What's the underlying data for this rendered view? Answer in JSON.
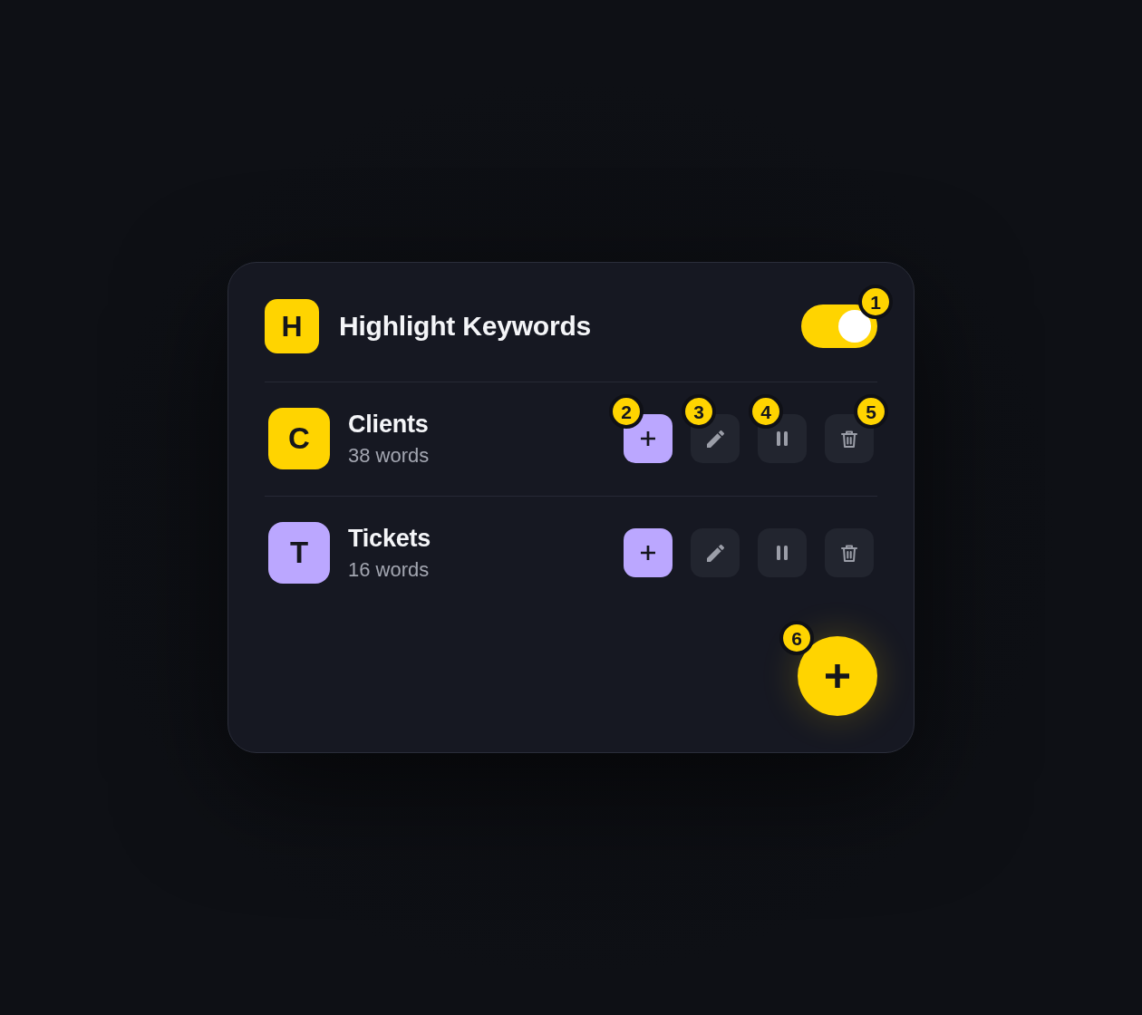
{
  "header": {
    "avatar": "H",
    "title": "Highlight Keywords",
    "toggle": {
      "on": true,
      "callout": "1"
    }
  },
  "lists": [
    {
      "avatar": "C",
      "color": "#ffd400",
      "name": "Clients",
      "count": "38 words",
      "actions": [
        {
          "kind": "add",
          "callout": "2"
        },
        {
          "kind": "edit",
          "callout": "3"
        },
        {
          "kind": "pause",
          "callout": "4"
        },
        {
          "kind": "delete",
          "callout": "5"
        }
      ]
    },
    {
      "avatar": "T",
      "color": "#bba7ff",
      "name": "Tickets",
      "count": "16 words",
      "actions": [
        {
          "kind": "add"
        },
        {
          "kind": "edit"
        },
        {
          "kind": "pause"
        },
        {
          "kind": "delete"
        }
      ]
    }
  ],
  "fab": {
    "kind": "add",
    "callout": "6"
  }
}
